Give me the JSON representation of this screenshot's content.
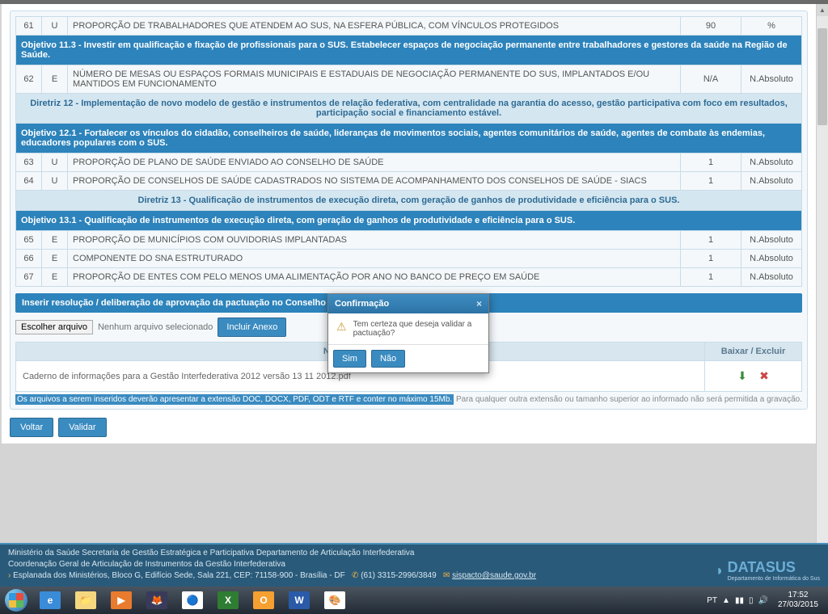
{
  "rows": {
    "r61": {
      "n": "61",
      "t": "U",
      "desc": "PROPORÇÃO DE TRABALHADORES QUE ATENDEM AO SUS, NA ESFERA PÚBLICA, COM VÍNCULOS PROTEGIDOS",
      "val": "90",
      "unit": "%"
    },
    "r62": {
      "n": "62",
      "t": "E",
      "desc": "NÚMERO DE MESAS OU ESPAÇOS FORMAIS MUNICIPAIS E ESTADUAIS DE NEGOCIAÇÃO PERMANENTE DO SUS, IMPLANTADOS E/OU MANTIDOS EM FUNCIONAMENTO",
      "val": "N/A",
      "unit": "N.Absoluto"
    },
    "r63": {
      "n": "63",
      "t": "U",
      "desc": "PROPORÇÃO DE PLANO DE SAÚDE ENVIADO AO CONSELHO DE SAÚDE",
      "val": "1",
      "unit": "N.Absoluto"
    },
    "r64": {
      "n": "64",
      "t": "U",
      "desc": "PROPORÇÃO DE CONSELHOS DE SAÚDE CADASTRADOS NO SISTEMA DE ACOMPANHAMENTO DOS CONSELHOS DE SAÚDE - SIACS",
      "val": "1",
      "unit": "N.Absoluto"
    },
    "r65": {
      "n": "65",
      "t": "E",
      "desc": "PROPORÇÃO DE MUNICÍPIOS COM OUVIDORIAS IMPLANTADAS",
      "val": "1",
      "unit": "N.Absoluto"
    },
    "r66": {
      "n": "66",
      "t": "E",
      "desc": "COMPONENTE DO SNA ESTRUTURADO",
      "val": "1",
      "unit": "N.Absoluto"
    },
    "r67": {
      "n": "67",
      "t": "E",
      "desc": "PROPORÇÃO DE ENTES COM PELO MENOS UMA ALIMENTAÇÃO POR ANO NO BANCO DE PREÇO EM SAÚDE",
      "val": "1",
      "unit": "N.Absoluto"
    }
  },
  "headers": {
    "obj113": "Objetivo 11.3 - Investir em qualificação e fixação de profissionais para o SUS. Estabelecer espaços de negociação permanente entre trabalhadores e gestores da saúde na Região de Saúde.",
    "dir12": "Diretriz 12 - Implementação de novo modelo de gestão e instrumentos de relação federativa, com centralidade na garantia do acesso, gestão participativa com foco em resultados, participação social e financiamento estável.",
    "obj121": "Objetivo 12.1 - Fortalecer os vínculos do cidadão, conselheiros de saúde, lideranças de movimentos sociais, agentes comunitários de saúde, agentes de combate às endemias, educadores populares com o SUS.",
    "dir13": "Diretriz 13 - Qualificação de instrumentos de execução direta, com geração de ganhos de produtividade e eficiência para o SUS.",
    "obj131": "Objetivo 13.1 - Qualificação de instrumentos de execução direta, com geração de ganhos de produtividade e eficiência para o SUS."
  },
  "upload": {
    "section_title": "Inserir resolução / deliberação de aprovação da pactuação no Conselho de Saúde",
    "choose_btn": "Escolher arquivo",
    "no_file": "Nenhum arquivo selecionado",
    "include_btn": "Incluir Anexo",
    "col_name": "Nome do Arquivo",
    "col_actions": "Baixar / Excluir",
    "file_name": "Caderno de informações para a Gestão Interfederativa 2012 versão 13 11 2012.pdf",
    "hint_hl": "Os arquivos a serem inseridos deverão apresentar a extensão DOC, DOCX, PDF, ODT e RTF e conter no máximo 15Mb.",
    "hint_rest": " Para qualquer outra extensão ou tamanho superior ao informado não será permitida a gravação."
  },
  "actions": {
    "back": "Voltar",
    "validate": "Validar"
  },
  "modal": {
    "title": "Confirmação",
    "body": "Tem certeza que deseja validar a pactuação?",
    "yes": "Sim",
    "no": "Não"
  },
  "footer": {
    "l1": "Ministério da Saúde Secretaria de Gestão Estratégica e Participativa Departamento de Articulação Interfederativa",
    "l2": "Coordenação Geral de Articulação de Instrumentos da Gestão Interfederativa",
    "addr_prefix": "Esplanada dos Ministérios, Bloco G, Edifício Sede, Sala 221, CEP: 71158-900 - Brasília - DF",
    "phone": "(61) 3315-2996/3849",
    "email": "sispacto@saude.gov.br",
    "logo": "DATASUS",
    "logo_sub": "Departamento de Informática do Sus"
  },
  "taskbar": {
    "lang": "PT",
    "time": "17:52",
    "date": "27/03/2015"
  }
}
